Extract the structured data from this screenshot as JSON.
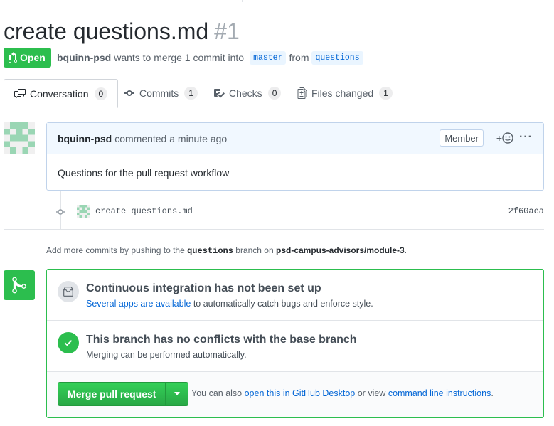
{
  "pr": {
    "title": "create questions.md",
    "number": "#1",
    "state": "Open",
    "author": "bquinn-psd",
    "merge_text_1": "wants to merge 1 commit into",
    "base_branch": "master",
    "from_text": "from",
    "head_branch": "questions"
  },
  "tabs": [
    {
      "label": "Conversation",
      "count": "0",
      "icon": "comment-discussion-icon"
    },
    {
      "label": "Commits",
      "count": "1",
      "icon": "git-commit-icon"
    },
    {
      "label": "Checks",
      "count": "0",
      "icon": "checklist-icon"
    },
    {
      "label": "Files changed",
      "count": "1",
      "icon": "file-diff-icon"
    }
  ],
  "comment": {
    "author": "bquinn-psd",
    "action": "commented",
    "time": "a minute ago",
    "badge": "Member",
    "reaction": "+",
    "body": "Questions for the pull request workflow"
  },
  "commit": {
    "message": "create questions.md",
    "sha": "2f60aea"
  },
  "hint": {
    "prefix": "Add more commits by pushing to the",
    "branch": "questions",
    "middle": "branch on",
    "repo": "psd-campus-advisors/module-3",
    "suffix": "."
  },
  "merge": {
    "ci_title": "Continuous integration has not been set up",
    "ci_link": "Several apps are available",
    "ci_rest": "to automatically catch bugs and enforce style.",
    "ok_title": "This branch has no conflicts with the base branch",
    "ok_sub": "Merging can be performed automatically.",
    "button": "Merge pull request",
    "alt_prefix": "You can also",
    "alt_link1": "open this in GitHub Desktop",
    "alt_mid": "or view",
    "alt_link2": "command line instructions",
    "alt_suffix": "."
  },
  "colors": {
    "open_green": "#2cbe4e",
    "link_blue": "#0366d6",
    "comment_header_bg": "#f1f8ff"
  }
}
